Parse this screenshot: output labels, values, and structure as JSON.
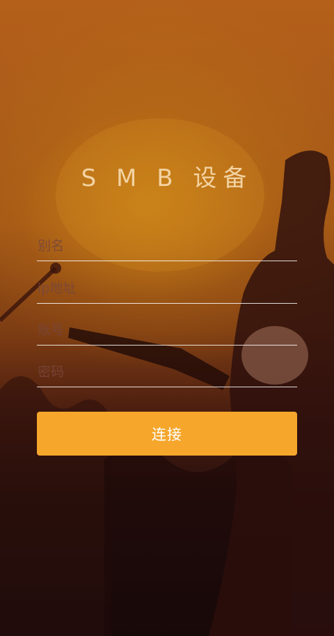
{
  "screen": {
    "title": "S M B 设备"
  },
  "form": {
    "name_placeholder": "别名",
    "ip_placeholder": "ip地址",
    "account_placeholder": "账号",
    "password_placeholder": "密码",
    "connect_label": "连接"
  },
  "colors": {
    "accent": "#f5a62b",
    "title": "#f3d3a3",
    "background_top": "#b4601a",
    "background_bottom": "#160a0c"
  }
}
